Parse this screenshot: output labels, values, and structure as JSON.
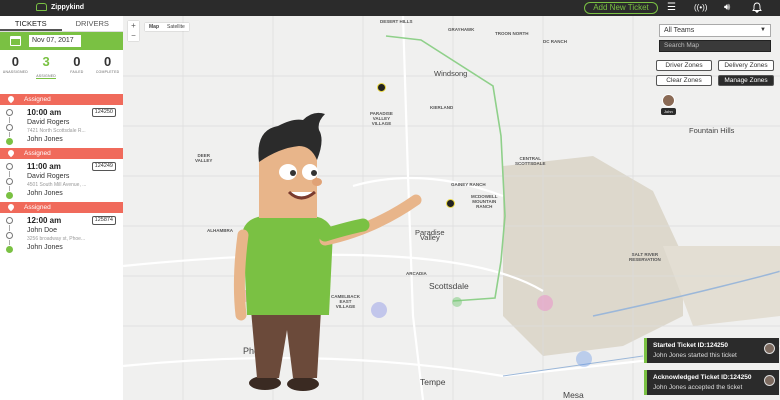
{
  "app": {
    "name": "Zippykind"
  },
  "header": {
    "new_ticket_label": "Add New Ticket"
  },
  "sidebar": {
    "tabs": [
      {
        "label": "TICKETS"
      },
      {
        "label": "DRIVERS"
      }
    ],
    "date": "Nov 07, 2017",
    "stats": [
      {
        "value": "0",
        "label": "UNASSIGNED"
      },
      {
        "value": "3",
        "label": "ASSIGNED"
      },
      {
        "value": "0",
        "label": "FAILED"
      },
      {
        "value": "0",
        "label": "COMPLETED"
      }
    ],
    "groups": [
      {
        "header": "Assigned",
        "time": "10:00 am",
        "ticket_id": "124250",
        "customer": "David Rogers",
        "address": "7421 North Scottsdale R...",
        "driver": "John Jones"
      },
      {
        "header": "Assigned",
        "time": "11:00 am",
        "ticket_id": "124249",
        "customer": "David Rogers",
        "address": "4501 South Mill Avenue, ...",
        "driver": "John Jones"
      },
      {
        "header": "Assigned",
        "time": "12:00 am",
        "ticket_id": "125874",
        "customer": "John Doe",
        "address": "3256 broadway st, Phoe...",
        "driver": "John Jones"
      }
    ]
  },
  "map": {
    "zoom_in": "+",
    "zoom_out": "−",
    "map_type": [
      "Map",
      "Satellite"
    ],
    "team_select": "All Teams",
    "search_placeholder": "Search Map",
    "buttons": {
      "driver_zones": "Driver Zones",
      "delivery_zones": "Delivery Zones",
      "clear_zones": "Clear Zones",
      "manage_zones": "Manage Zones"
    },
    "driver_label": "John",
    "labels": {
      "desert_hills": "DESERT HILLS",
      "grayhawk": "GRAYHAWK",
      "troon_north": "TROON NORTH",
      "dc_ranch": "DC RANCH",
      "windsong": "Windsong",
      "kierland": "KIERLAND",
      "paradise_valley_village": "PARADISE\nVALLEY\nVILLAGE",
      "fountain_hills": "Fountain Hills",
      "deer_valley": "DEER\nVALLEY",
      "central_scottsdale": "CENTRAL\nSCOTTSDALE",
      "gainey_ranch": "GAINEY RANCH",
      "mcdowell_mountain": "MCDOWELL\nMOUNTAIN\nRANCH",
      "paradise_valley": "Paradise\nValley",
      "alhambra": "ALHAMBRA",
      "arcadia": "ARCADIA",
      "salt_river": "SALT RIVER\nRESERVATION",
      "scottsdale": "Scottsdale",
      "camelback": "CAMELBACK\nEAST\nVILLAGE",
      "phoenix": "Phoenix",
      "tempe": "Tempe",
      "mesa": "Mesa"
    }
  },
  "toasts": [
    {
      "title": "Started Ticket ID:124250",
      "body": "John Jones started this ticket"
    },
    {
      "title": "Acknowledged Ticket ID:124250",
      "body": "John Jones accepted the ticket"
    }
  ],
  "colors": {
    "brand_green": "#7ac143",
    "assigned_red": "#f06a5b",
    "dark": "#2b2b2b"
  },
  "icons": {
    "menu": "hamburger-icon",
    "broadcast": "broadcast-icon",
    "volume": "volume-icon",
    "bell": "bell-icon",
    "calendar": "calendar-icon"
  }
}
